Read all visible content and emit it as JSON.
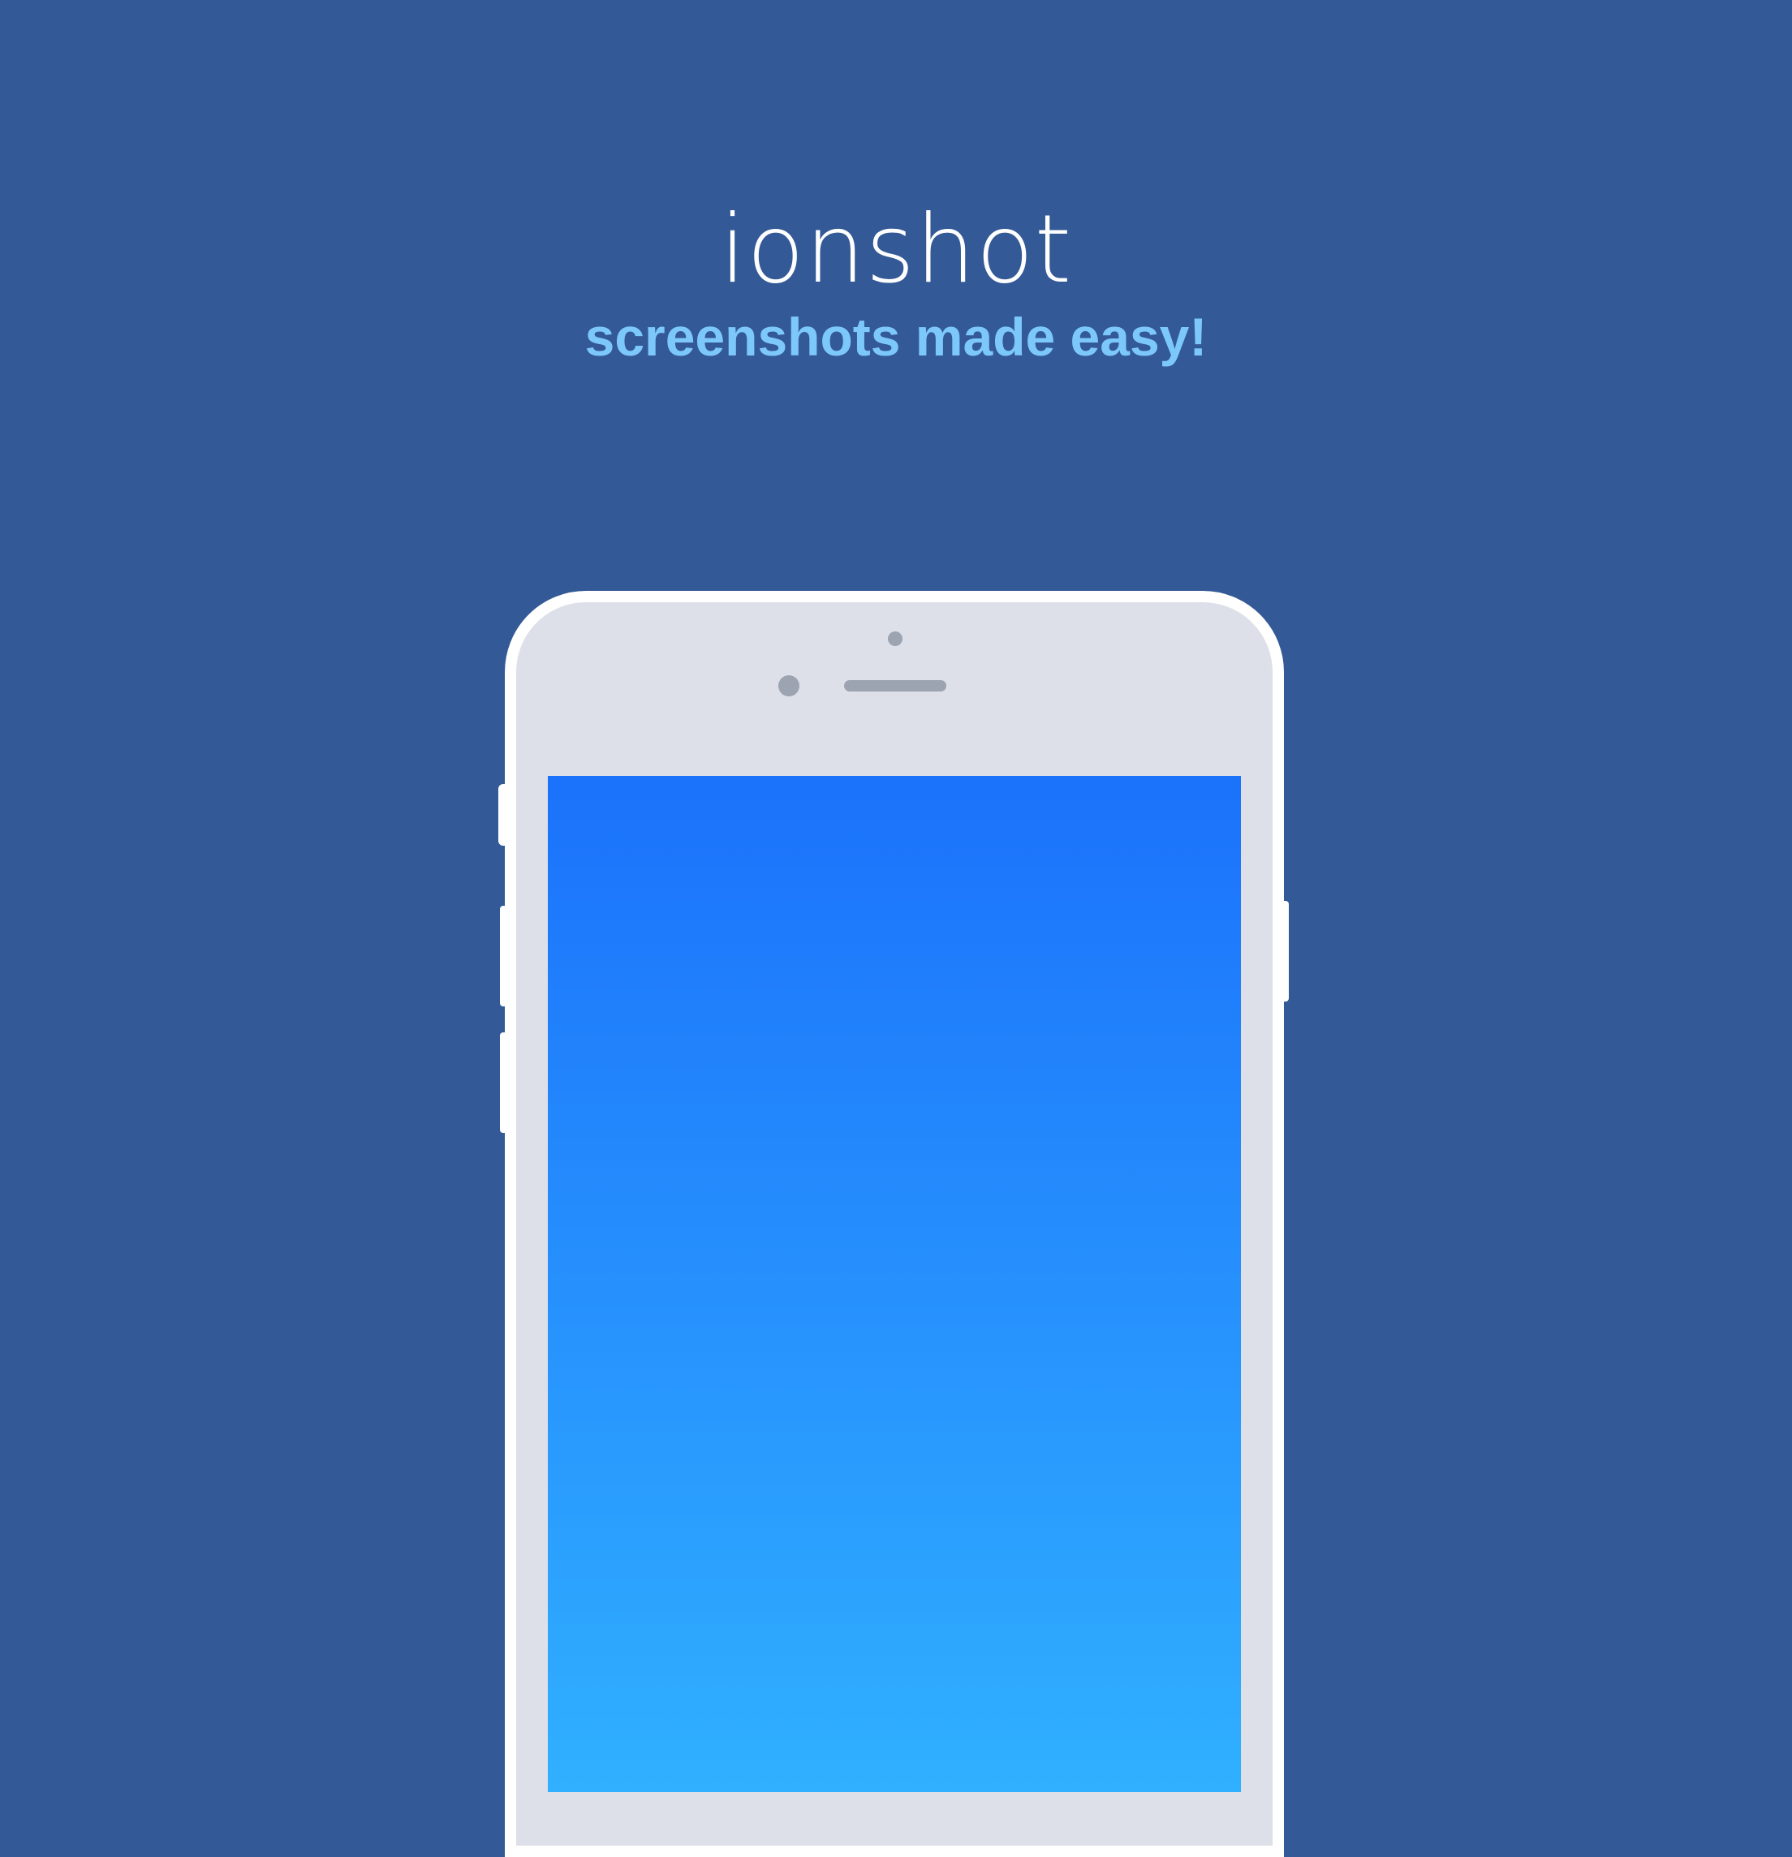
{
  "brand": {
    "title": "ionshot",
    "tagline": "screenshots made easy!"
  },
  "colors": {
    "background": "#335996",
    "title": "#ffffff",
    "tagline": "#7dc8fa",
    "phone_body": "#dde0e8",
    "phone_frame": "#ffffff",
    "screen_top": "#1b72fb",
    "screen_bottom": "#30b0ff"
  },
  "icons": {
    "phone": "phone-mockup-icon",
    "camera": "camera-icon",
    "speaker": "speaker-icon"
  }
}
